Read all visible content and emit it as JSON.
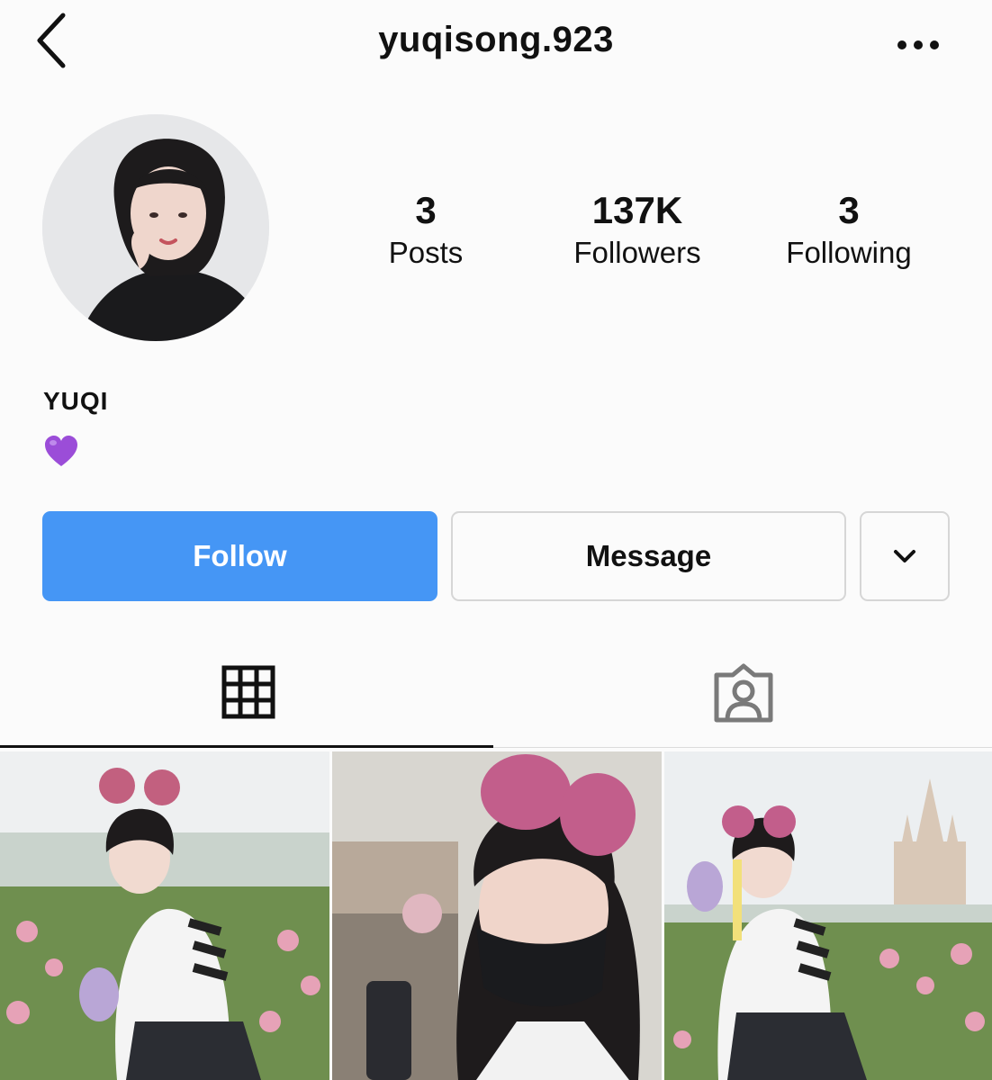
{
  "header": {
    "username": "yuqisong.923",
    "back_icon": "chevron-left-icon",
    "more_icon": "more-horizontal-icon"
  },
  "profile": {
    "stats": [
      {
        "value": "3",
        "label": "Posts"
      },
      {
        "value": "137K",
        "label": "Followers"
      },
      {
        "value": "3",
        "label": "Following"
      }
    ],
    "name": "YUQI",
    "bio_emoji": "purple-heart-icon"
  },
  "actions": {
    "follow_label": "Follow",
    "message_label": "Message",
    "more_icon": "chevron-down-icon"
  },
  "tabs": [
    {
      "icon": "grid-icon",
      "selected": true
    },
    {
      "icon": "tagged-person-icon",
      "selected": false
    }
  ],
  "posts_count_visible": 3,
  "colors": {
    "follow_button": "#4596f5",
    "background": "#fbfbfb",
    "heart": "#9b4dd8"
  }
}
